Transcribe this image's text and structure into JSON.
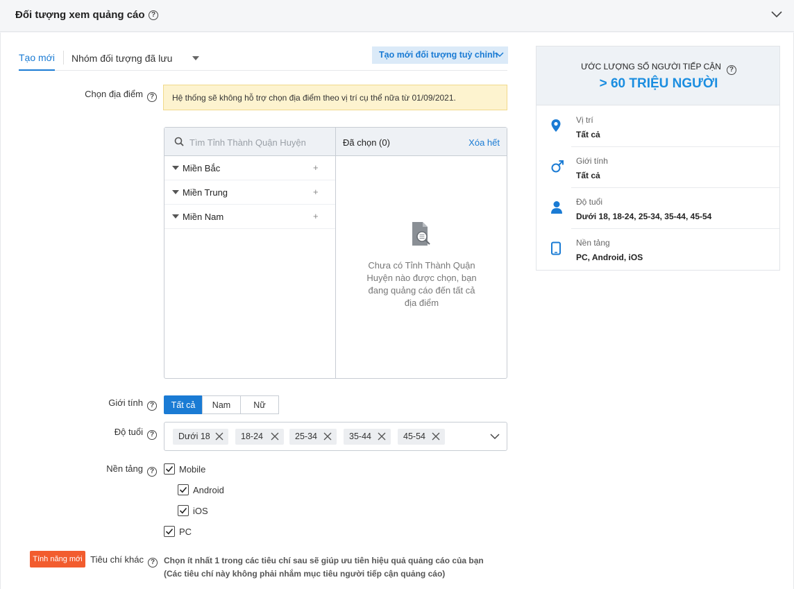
{
  "header": {
    "title": "Đối tượng xem quảng cáo"
  },
  "tabs": {
    "new": "Tạo mới",
    "saved": "Nhóm đối tượng đã lưu",
    "custom_button": "Tạo mới đối tượng tuỳ chỉnh"
  },
  "location": {
    "label": "Chọn địa điểm",
    "notice": "Hệ thống sẽ không hỗ trợ chọn địa điểm theo vị trí cụ thể nữa từ 01/09/2021.",
    "search_placeholder": "Tìm Tỉnh Thành Quận Huyện",
    "regions": [
      "Miền Bắc",
      "Miền Trung",
      "Miền Nam"
    ],
    "chosen": "Đã chọn (0)",
    "clear_all": "Xóa hết",
    "empty_message": "Chưa có Tỉnh Thành Quận Huyện nào được chọn, bạn đang quảng cáo đến tất cả địa điểm"
  },
  "gender": {
    "label": "Giới tính",
    "options": [
      "Tất cả",
      "Nam",
      "Nữ"
    ],
    "selected": "Tất cả"
  },
  "age": {
    "label": "Độ tuổi",
    "chips": [
      "Dưới 18",
      "18-24",
      "25-34",
      "35-44",
      "45-54"
    ]
  },
  "platform": {
    "label": "Nền tảng",
    "mobile": "Mobile",
    "android": "Android",
    "ios": "iOS",
    "pc": "PC",
    "checked": {
      "mobile": true,
      "android": true,
      "ios": true,
      "pc": true
    }
  },
  "other": {
    "badge": "Tính năng mới",
    "label": "Tiêu chí khác",
    "line1": "Chọn ít nhất 1 trong các tiêu chí sau sẽ giúp ưu tiên hiệu quả quảng cáo của bạn",
    "line2": "(Các tiêu chí này không phải nhắm mục tiêu người tiếp cận quảng cáo)"
  },
  "estimate": {
    "title": "ƯỚC LƯỢNG SỐ NGƯỜI TIẾP CẬN",
    "value": "> 60 TRIỆU NGƯỜI",
    "rows": [
      {
        "icon": "location-pin-icon",
        "key": "Vị trí",
        "value": "Tất cả"
      },
      {
        "icon": "male-gender-icon",
        "key": "Giới tính",
        "value": "Tất cả"
      },
      {
        "icon": "person-icon",
        "key": "Độ tuổi",
        "value": "Dưới 18, 18-24, 25-34, 35-44, 45-54"
      },
      {
        "icon": "tablet-icon",
        "key": "Nền tảng",
        "value": "PC, Android, iOS"
      }
    ]
  },
  "colors": {
    "accent": "#1a7bd4",
    "badge": "#f25c2e",
    "notice_bg": "#fdf3cf"
  }
}
